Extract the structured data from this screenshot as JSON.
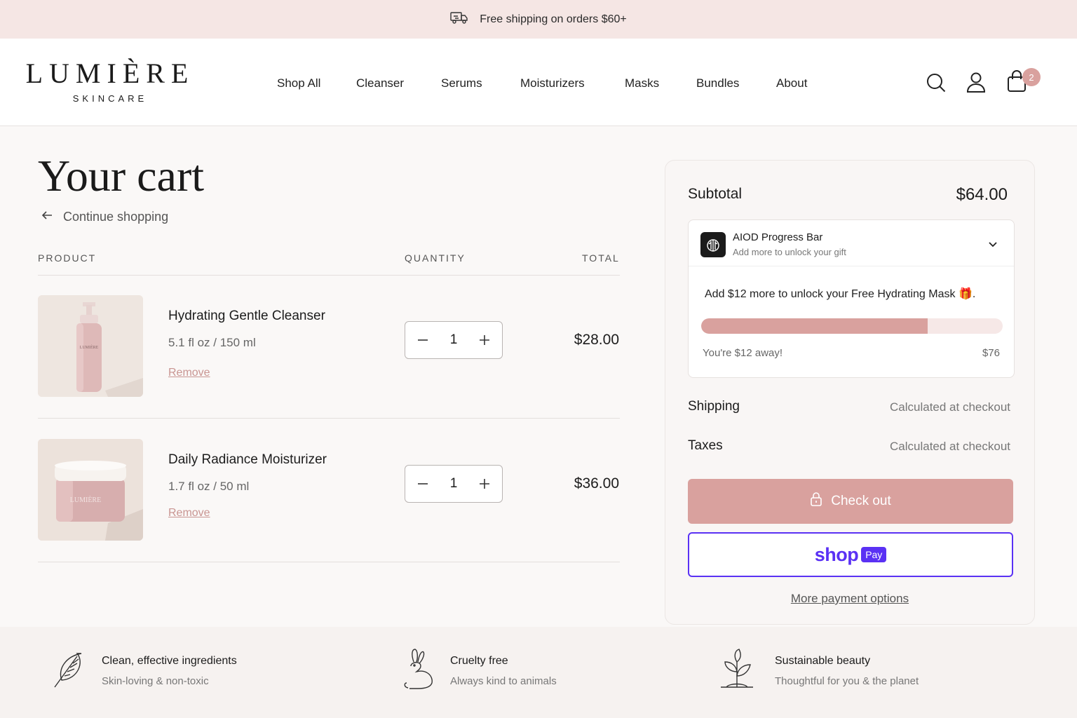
{
  "announcement": {
    "text": "Free shipping on orders $60+",
    "icon": "truck-icon"
  },
  "brand": {
    "name": "LUMIÈRE",
    "tagline": "SKINCARE"
  },
  "nav": {
    "items": [
      {
        "label": "Shop All"
      },
      {
        "label": "Cleanser"
      },
      {
        "label": "Serums"
      },
      {
        "label": "Moisturizers"
      },
      {
        "label": "Masks"
      },
      {
        "label": "Bundles"
      },
      {
        "label": "About"
      }
    ]
  },
  "header_icons": {
    "search": "search-icon",
    "account": "user-icon",
    "cart": "bag-icon",
    "cart_count": "2"
  },
  "cart": {
    "title": "Your cart",
    "continue_label": "Continue shopping",
    "columns": {
      "product": "PRODUCT",
      "quantity": "QUANTITY",
      "total": "TOTAL"
    },
    "items": [
      {
        "name": "Hydrating Gentle Cleanser",
        "variant": "5.1 fl oz / 150 ml",
        "remove": "Remove",
        "quantity": "1",
        "total": "$28.00"
      },
      {
        "name": "Daily Radiance Moisturizer",
        "variant": "1.7 fl oz / 50 ml",
        "remove": "Remove",
        "quantity": "1",
        "total": "$36.00"
      }
    ]
  },
  "summary": {
    "subtotal_label": "Subtotal",
    "subtotal_value": "$64.00",
    "progress_widget": {
      "title": "AIOD Progress Bar",
      "subtitle": "Add more to unlock your gift",
      "message": "Add $12 more to unlock your Free Hydrating Mask 🎁.",
      "away_text": "You're $12 away!",
      "goal_text": "$76",
      "progress_fraction": 0.75
    },
    "shipping_label": "Shipping",
    "shipping_value": "Calculated at checkout",
    "taxes_label": "Taxes",
    "taxes_value": "Calculated at checkout",
    "checkout_label": "Check out",
    "shoppay_word": "shop",
    "shoppay_badge": "Pay",
    "more_payment": "More payment options"
  },
  "features": [
    {
      "title": "Clean, effective ingredients",
      "subtitle": "Skin-loving & non-toxic",
      "icon": "leaf-icon"
    },
    {
      "title": "Cruelty free",
      "subtitle": "Always kind to animals",
      "icon": "rabbit-icon"
    },
    {
      "title": "Sustainable beauty",
      "subtitle": "Thoughtful for you & the planet",
      "icon": "sprout-icon"
    }
  ],
  "colors": {
    "accent": "#d9a19e",
    "announce_bg": "#f5e6e4",
    "shoppay": "#5a31f4"
  }
}
